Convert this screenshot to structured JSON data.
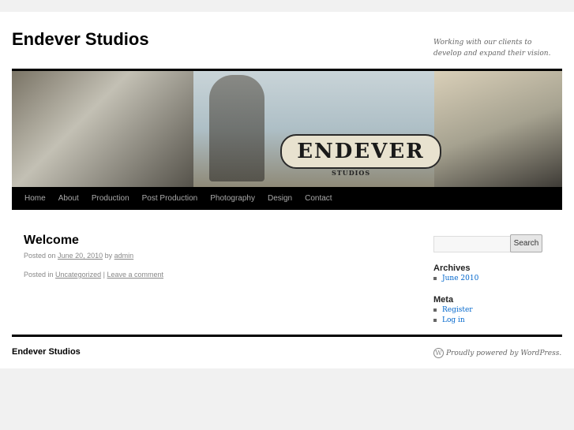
{
  "site": {
    "title": "Endever Studios",
    "description": "Working with our clients to develop and expand their vision.",
    "banner_logo": "ENDEVER",
    "banner_sub": "STUDIOS"
  },
  "nav": [
    "Home",
    "About",
    "Production",
    "Post Production",
    "Photography",
    "Design",
    "Contact"
  ],
  "post": {
    "title": "Welcome",
    "posted_on": "Posted on",
    "date": "June 20, 2010",
    "by": "by",
    "author": "admin",
    "posted_in": "Posted in",
    "category": "Uncategorized",
    "sep": "|",
    "comment": "Leave a comment"
  },
  "sidebar": {
    "search_placeholder": "",
    "search_button": "Search",
    "archives_title": "Archives",
    "archives": [
      "June 2010"
    ],
    "meta_title": "Meta",
    "meta": [
      "Register",
      "Log in"
    ]
  },
  "footer": {
    "title": "Endever Studios",
    "powered": "Proudly powered by WordPress."
  }
}
